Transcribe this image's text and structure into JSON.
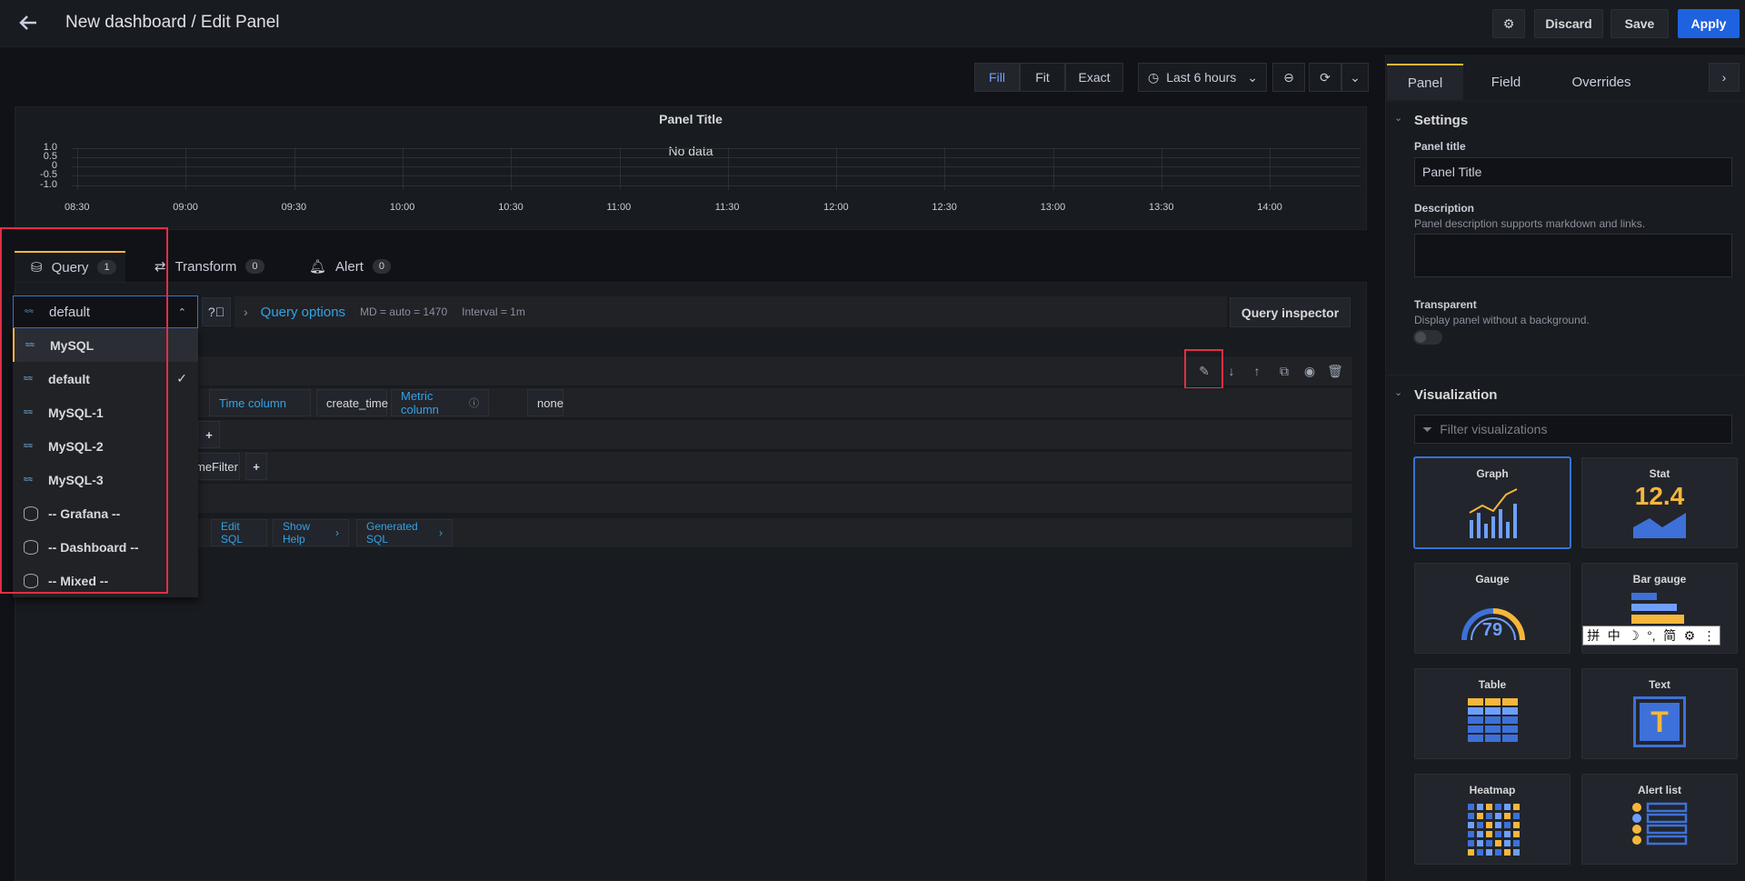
{
  "header": {
    "title": "New dashboard / Edit Panel",
    "discard": "Discard",
    "save": "Save",
    "apply": "Apply"
  },
  "toolbar": {
    "fill": "Fill",
    "fit": "Fit",
    "exact": "Exact",
    "time_range": "Last 6 hours"
  },
  "panel": {
    "title": "Panel Title",
    "no_data": "No data",
    "y_ticks": [
      "1.0",
      "0.5",
      "0",
      "-0.5",
      "-1.0"
    ],
    "x_ticks": [
      "08:30",
      "09:00",
      "09:30",
      "10:00",
      "10:30",
      "11:00",
      "11:30",
      "12:00",
      "12:30",
      "13:00",
      "13:30",
      "14:00"
    ]
  },
  "tabs": {
    "query": "Query",
    "query_count": "1",
    "transform": "Transform",
    "transform_count": "0",
    "alert": "Alert",
    "alert_count": "0"
  },
  "query": {
    "datasource_selected": "default",
    "options_label": "Query options",
    "md": "MD = auto = 1470",
    "interval": "Interval = 1m",
    "inspector": "Query inspector",
    "time_column_label": "Time column",
    "time_column_value": "create_time",
    "metric_column_label": "Metric column",
    "metric_column_value": "none",
    "timefilter_fragment": "meFilter",
    "edit_sql": "Edit SQL",
    "show_help": "Show Help",
    "generated_sql": "Generated SQL"
  },
  "datasource_menu": [
    {
      "label": "MySQL",
      "icon": "mysql-logo"
    },
    {
      "label": "default",
      "icon": "mysql-logo",
      "selected": true
    },
    {
      "label": "MySQL-1",
      "icon": "mysql-logo"
    },
    {
      "label": "MySQL-2",
      "icon": "mysql-logo"
    },
    {
      "label": "MySQL-3",
      "icon": "mysql-logo"
    },
    {
      "label": "-- Grafana --",
      "icon": "database-icon"
    },
    {
      "label": "-- Dashboard --",
      "icon": "database-icon"
    },
    {
      "label": "-- Mixed --",
      "icon": "database-icon"
    }
  ],
  "right": {
    "tabs": [
      "Panel",
      "Field",
      "Overrides"
    ],
    "settings_title": "Settings",
    "panel_title_label": "Panel title",
    "panel_title_value": "Panel Title",
    "description_label": "Description",
    "description_hint": "Panel description supports markdown and links.",
    "transparent_label": "Transparent",
    "transparent_hint": "Display panel without a background.",
    "viz_title": "Visualization",
    "viz_filter_placeholder": "Filter visualizations",
    "viz": [
      "Graph",
      "Stat",
      "Gauge",
      "Bar gauge",
      "Table",
      "Text",
      "Heatmap",
      "Alert list"
    ],
    "stat_value": "12.4",
    "gauge_value": "79",
    "text_glyph": "T"
  },
  "ime": [
    "拼",
    "中",
    "☽",
    "°,",
    "简",
    "⚙",
    "⋮"
  ],
  "colors": {
    "accent": "#f5b73b",
    "blue": "#3274d9",
    "apply": "#1f62e0",
    "highlight": "#e02f44"
  }
}
